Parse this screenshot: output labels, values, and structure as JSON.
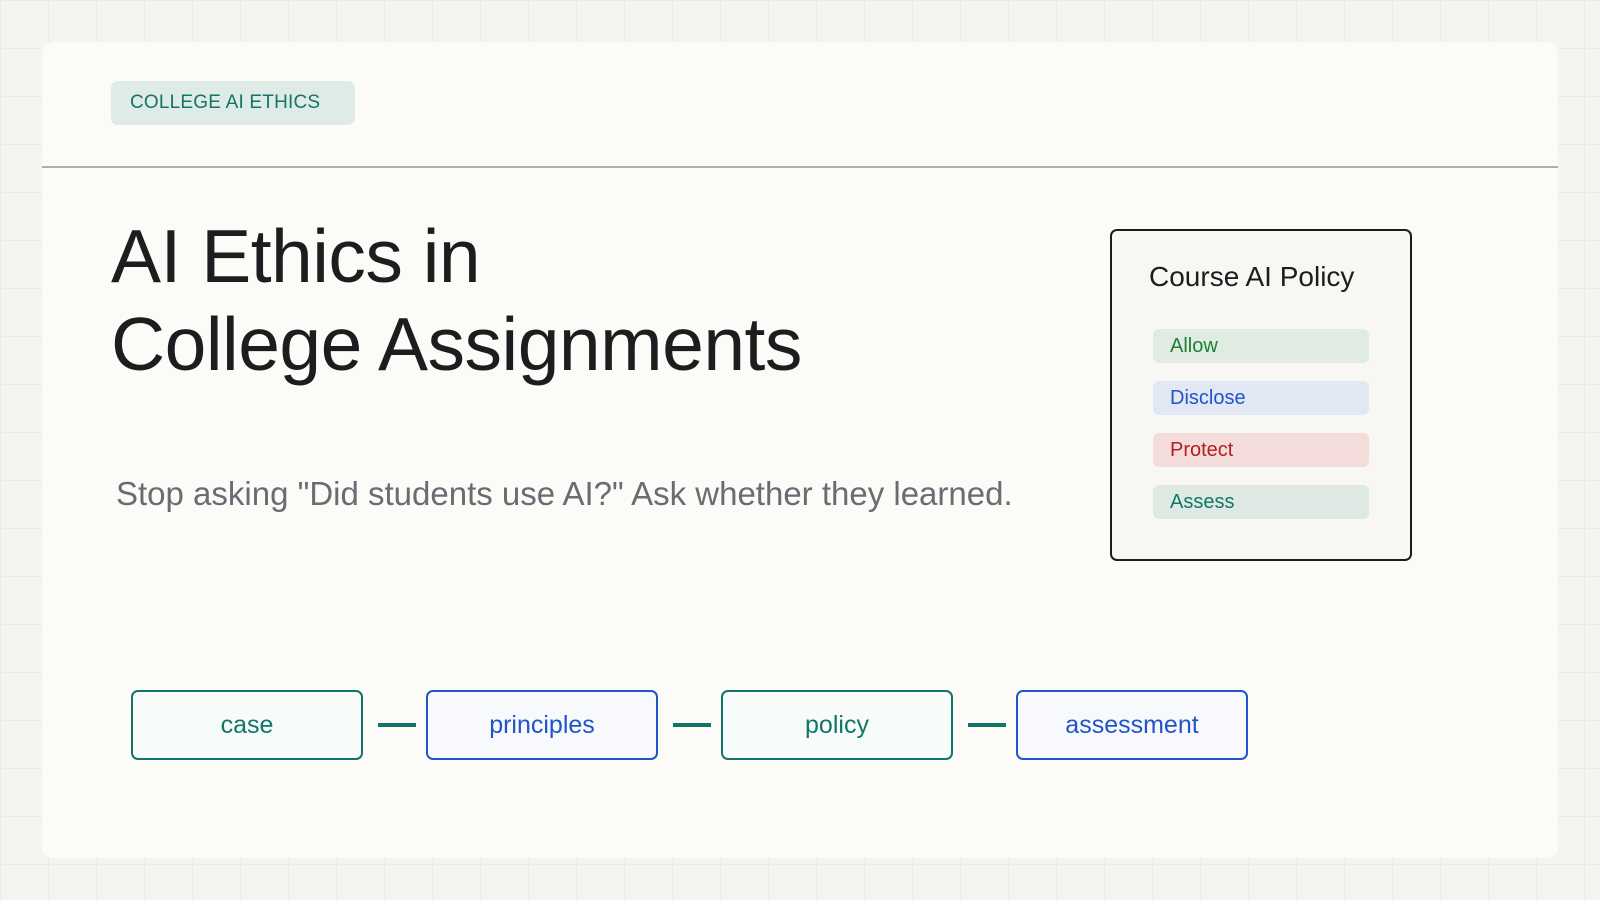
{
  "header": {
    "tag": "COLLEGE AI ETHICS"
  },
  "hero": {
    "title_line1": "AI Ethics in",
    "title_line2": "College Assignments",
    "subtitle": "Stop asking \"Did students use AI?\" Ask whether they learned."
  },
  "policy": {
    "title": "Course AI Policy",
    "items": [
      {
        "label": "Allow"
      },
      {
        "label": "Disclose"
      },
      {
        "label": "Protect"
      },
      {
        "label": "Assess"
      }
    ]
  },
  "flow": {
    "steps": [
      {
        "label": "case"
      },
      {
        "label": "principles"
      },
      {
        "label": "policy"
      },
      {
        "label": "assessment"
      }
    ]
  },
  "colors": {
    "accent_teal": "#127568",
    "accent_blue": "#2154c8",
    "allow_green": "#1c7f34",
    "protect_red": "#b41e1e"
  }
}
